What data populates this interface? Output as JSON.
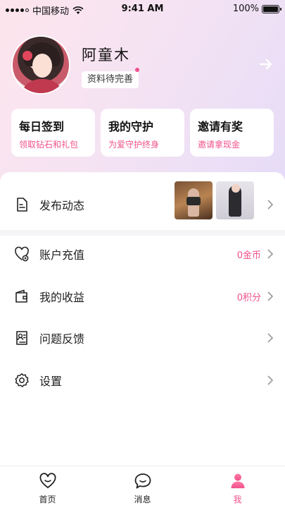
{
  "status_bar": {
    "carrier": "中国移动",
    "time": "9:41 AM",
    "battery": "100%"
  },
  "profile": {
    "name": "阿童木",
    "tag": "资料待完善"
  },
  "cards": [
    {
      "title": "每日签到",
      "subtitle": "领取钻石和礼包"
    },
    {
      "title": "我的守护",
      "subtitle": "为爱守护终身"
    },
    {
      "title": "邀请有奖",
      "subtitle": "邀请拿现金"
    }
  ],
  "menu": {
    "post": {
      "label": "发布动态"
    },
    "recharge": {
      "label": "账户充值",
      "value": "0金币"
    },
    "earnings": {
      "label": "我的收益",
      "value": "0积分"
    },
    "feedback": {
      "label": "问题反馈"
    },
    "settings": {
      "label": "设置"
    }
  },
  "tabbar": {
    "home": "首页",
    "messages": "消息",
    "me": "我"
  },
  "colors": {
    "accent": "#f0518c",
    "text": "#222222"
  }
}
